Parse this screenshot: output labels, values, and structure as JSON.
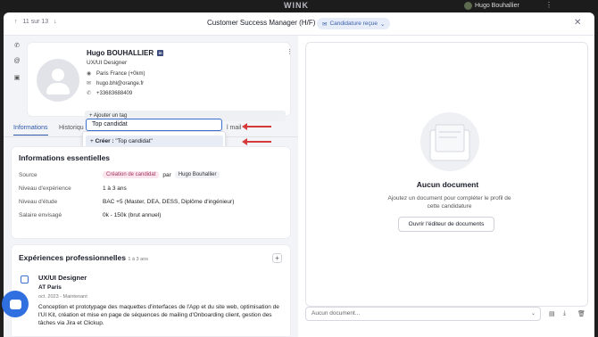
{
  "topbar": {
    "brand": "WINK",
    "user": "Hugo Bouhallier",
    "dots": "⋮"
  },
  "header": {
    "up": "↑",
    "counter": "11 sur 13",
    "down": "↓",
    "title": "Customer Success Manager (H/F)",
    "status": "Candidature reçue",
    "close": "✕"
  },
  "rail": {
    "phone": "✆",
    "at": "@",
    "cal": "▣"
  },
  "profile": {
    "name": "Hugo BOUHALLIER",
    "linkedin": "in",
    "job": "UX/UI Designer",
    "location": "Paris France  (+0km)",
    "email": "hugo.bhl@orange.fr",
    "phone": "+33683688409",
    "add_tag": "+ Ajouter un tag",
    "menu": "⋮"
  },
  "tabs": {
    "informations": "Informations",
    "historique": "Historiqu",
    "email": "l mail"
  },
  "tag_input": {
    "value": "Top candidat"
  },
  "dropdown": {
    "plus": "+",
    "create_label": "Créer :",
    "create_value": " \"Top candidat\""
  },
  "essentials": {
    "title": "Informations essentielles",
    "source_label": "Source",
    "source_badge": "Création de candidat",
    "source_par": "par",
    "source_user": "Hugo Bouhallier",
    "exp_label": "Niveau d'expérience",
    "exp_value": "1 à 3 ans",
    "study_label": "Niveau d'étude",
    "study_value": "BAC +5 (Master, DEA, DESS, Diplôme d'ingénieur)",
    "salary_label": "Salaire envisagé",
    "salary_value": "0k - 150k (brut annuel)"
  },
  "experiences": {
    "title": "Expériences professionnelles",
    "count": "1 à 3 ans",
    "add": "+",
    "job": "UX/UI Designer",
    "company": "AT Paris",
    "dates": "oct. 2023 - Maintenant",
    "desc": "Conception et prototypage des maquettes d'interfaces de l'App et du site web, optimisation de l'UI Kit, création et mise en page de séquences de mailing d'Onboarding client, gestion des tâches via Jira et Clickup."
  },
  "documents": {
    "empty_title": "Aucun document",
    "empty_text": "Ajoutez un document pour compléter le profil de cette candidature",
    "open_button": "Ouvrir l'éditeur de documents",
    "select_placeholder": "Aucun document...",
    "chev": "⌄",
    "icon1": "▤",
    "icon2": "⤓",
    "icon3": "🗑"
  },
  "colors": {
    "accent": "#2e57a8",
    "arrow": "#d63a3a",
    "chat": "#2f6fe0"
  }
}
